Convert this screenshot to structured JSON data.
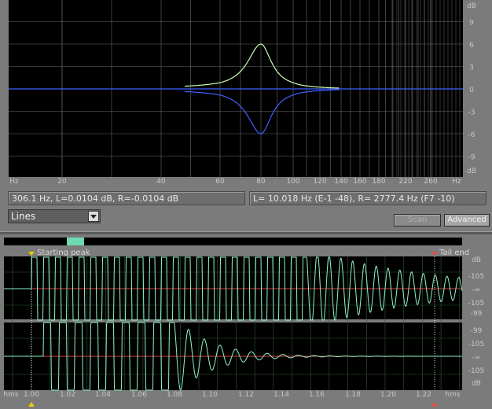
{
  "colors": {
    "background": "#7b7b7b",
    "plot_bg": "#000000",
    "grid": "#6a6a6a",
    "curve_green": "#c8ffb0",
    "curve_blue": "#3d62ff",
    "axis_text": "#c8c8c8",
    "waveform": "#8ef5c8",
    "zero_line": "#d84040",
    "marker_yellow": "#e8d000",
    "marker_red": "#e05050",
    "scrollbar_thumb": "#6fd9b0",
    "tick_cursor": "#cccccc"
  },
  "eq_graph": {
    "y_labels": [
      "dB",
      "9",
      "6",
      "3",
      "0",
      "-3",
      "-6",
      "-9",
      "dB"
    ],
    "x_labels": [
      "Hz",
      "20",
      "40",
      "60",
      "80",
      "100",
      "120",
      "140",
      "160",
      "180",
      "220",
      "260",
      "Hz"
    ]
  },
  "status": {
    "left": "306.1 Hz, L=0.0104 dB, R=-0.0104 dB",
    "right": "L= 10.018 Hz (E-1 -48), R= 2777.4 Hz (F7 -10)"
  },
  "display_mode": {
    "value": "Lines",
    "icon": "chevron-down-icon"
  },
  "buttons": {
    "scan": "Scan",
    "advanced": "Advanced"
  },
  "markers": {
    "start_label": "Starting peak",
    "tail_label": "Tail end"
  },
  "wave_top": {
    "y_labels": [
      "dB",
      "-105",
      "-∞",
      "-105",
      "-99"
    ]
  },
  "wave_bottom": {
    "y_labels": [
      "-99",
      "-105",
      "-∞",
      "-105",
      "dB"
    ]
  },
  "time_axis": {
    "labels": [
      "hms",
      "1.00",
      "1.02",
      "1.04",
      "1.06",
      "1.08",
      "1.10",
      "1.12",
      "1.14",
      "1.16",
      "1.18",
      "1.20",
      "1.22",
      "hms"
    ]
  },
  "chart_data": {
    "type": "line",
    "x": [
      20,
      40,
      60,
      70,
      75,
      78,
      80,
      82,
      85,
      90,
      100,
      120,
      140
    ],
    "xlabel": "Hz",
    "ylabel": "dB",
    "ylim": [
      -12,
      12
    ],
    "series": [
      {
        "values": [
          0,
          0,
          0.2,
          1.0,
          2.4,
          4.5,
          6.0,
          4.5,
          2.4,
          1.0,
          0.3,
          0.1,
          0
        ]
      },
      {
        "values": [
          0,
          0,
          -0.2,
          -1.0,
          -2.4,
          -4.5,
          -6.0,
          -4.5,
          -2.4,
          -1.0,
          -0.3,
          -0.1,
          0
        ]
      }
    ]
  }
}
